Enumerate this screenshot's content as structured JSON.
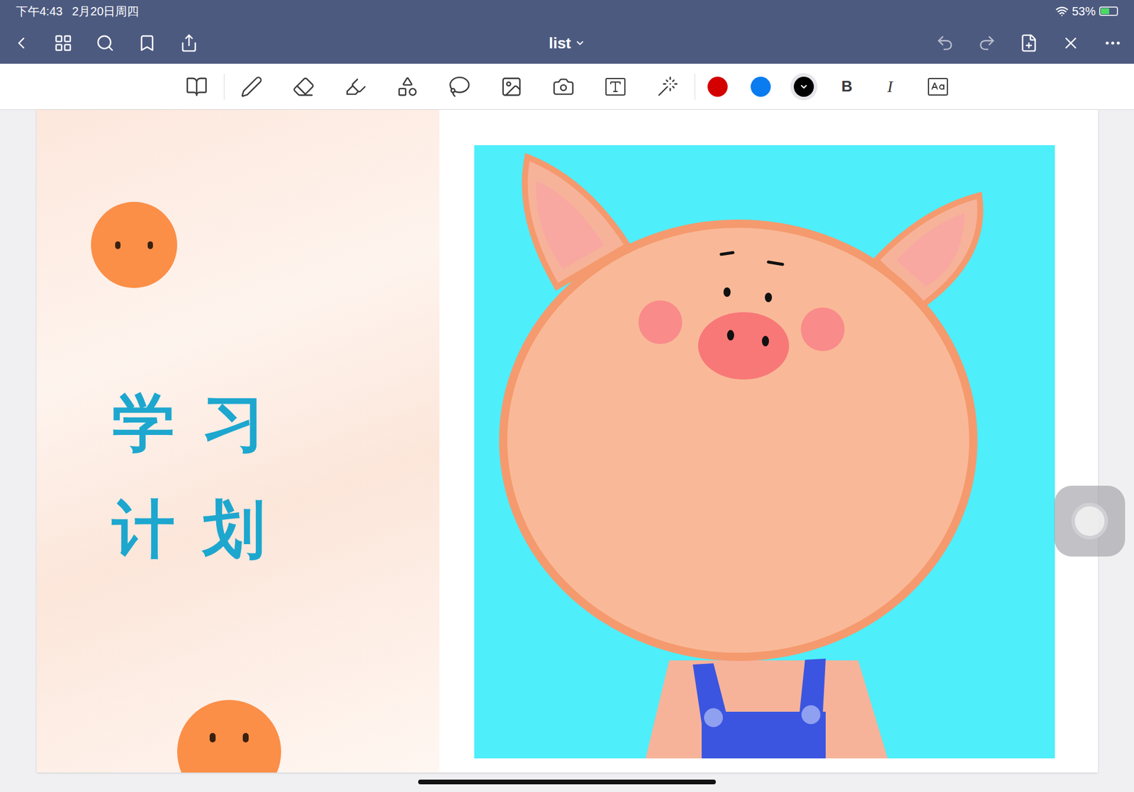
{
  "status_bar": {
    "time": "下午4:43",
    "date": "2月20日周四",
    "battery": "53%",
    "battery_level": 0.53,
    "charging": true
  },
  "document": {
    "title": "list"
  },
  "pen_colors": [
    {
      "color": "#d40000",
      "selected": false
    },
    {
      "color": "#0a7cf0",
      "selected": false
    },
    {
      "color": "#000000",
      "selected": true
    }
  ],
  "format": {
    "bold": "B",
    "italic": "I"
  },
  "cover": {
    "lines": [
      "学习",
      "计划"
    ]
  }
}
